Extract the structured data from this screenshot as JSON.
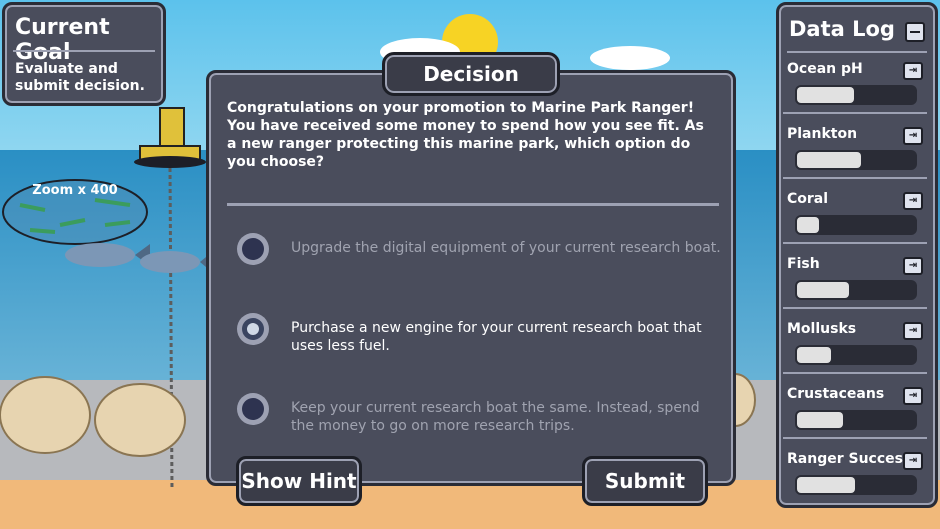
{
  "goal": {
    "title": "Current Goal",
    "text": "Evaluate and submit decision."
  },
  "scene": {
    "zoom_label": "Zoom x 400"
  },
  "decision": {
    "title": "Decision",
    "question": "Congratulations on your promotion to Marine Park Ranger! You have received some money to spend how you see fit. As a new ranger protecting this marine park, which option do you choose?",
    "options": [
      {
        "text": "Upgrade the digital equipment of your current research boat.",
        "selected": false
      },
      {
        "text": "Purchase a new engine for your current research boat that uses less fuel.",
        "selected": true
      },
      {
        "text": "Keep your current research boat the same. Instead, spend the money to go on more research trips.",
        "selected": false
      }
    ],
    "hint_label": "Show Hint",
    "submit_label": "Submit"
  },
  "log": {
    "title": "Data Log",
    "items": [
      {
        "label": "Ocean pH",
        "level": 0.48
      },
      {
        "label": "Plankton",
        "level": 0.54
      },
      {
        "label": "Coral",
        "level": 0.19
      },
      {
        "label": "Fish",
        "level": 0.44
      },
      {
        "label": "Mollusks",
        "level": 0.29
      },
      {
        "label": "Crustaceans",
        "level": 0.39
      },
      {
        "label": "Ranger Success",
        "level": 0.49
      }
    ]
  }
}
